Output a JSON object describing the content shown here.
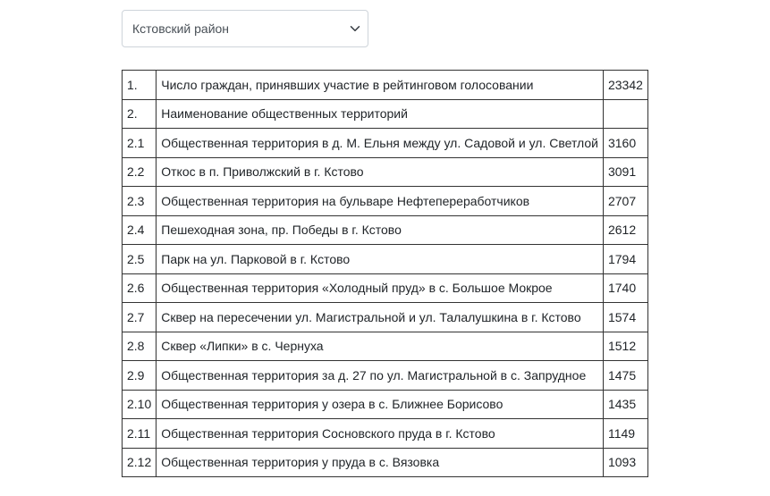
{
  "district_select": {
    "selected": "Кстовский район",
    "icon": "chevron-down-icon"
  },
  "table": {
    "rows": [
      {
        "num": "1.",
        "name": "Число граждан, принявших участие в рейтинговом голосовании",
        "votes": "23342"
      },
      {
        "num": "2.",
        "name": "Наименование общественных территорий",
        "votes": ""
      },
      {
        "num": "2.1",
        "name": "Общественная территория в д. М. Ельня между ул. Садовой и ул. Светлой",
        "votes": "3160"
      },
      {
        "num": "2.2",
        "name": "Откос в п. Приволжский в г. Кстово",
        "votes": "3091"
      },
      {
        "num": "2.3",
        "name": "Общественная территория на бульваре Нефтепереработчиков",
        "votes": "2707"
      },
      {
        "num": "2.4",
        "name": "Пешеходная зона, пр. Победы в г. Кстово",
        "votes": "2612"
      },
      {
        "num": "2.5",
        "name": "Парк на ул. Парковой в г. Кстово",
        "votes": "1794"
      },
      {
        "num": "2.6",
        "name": "Общественная территория «Холодный пруд» в с. Большое Мокрое",
        "votes": "1740"
      },
      {
        "num": "2.7",
        "name": "Сквер на пересечении ул. Магистральной и ул. Талалушкина в г. Кстово",
        "votes": "1574"
      },
      {
        "num": "2.8",
        "name": "Сквер «Липки» в с. Чернуха",
        "votes": "1512"
      },
      {
        "num": "2.9",
        "name": "Общественная территория за д. 27 по ул. Магистральной в с. Запрудное",
        "votes": "1475"
      },
      {
        "num": "2.10",
        "name": "Общественная территория у озера в с. Ближнее Борисово",
        "votes": "1435"
      },
      {
        "num": "2.11",
        "name": "Общественная территория Сосновского пруда в г. Кстово",
        "votes": "1149"
      },
      {
        "num": "2.12",
        "name": "Общественная территория у пруда в с. Вязовка",
        "votes": "1093"
      }
    ]
  }
}
